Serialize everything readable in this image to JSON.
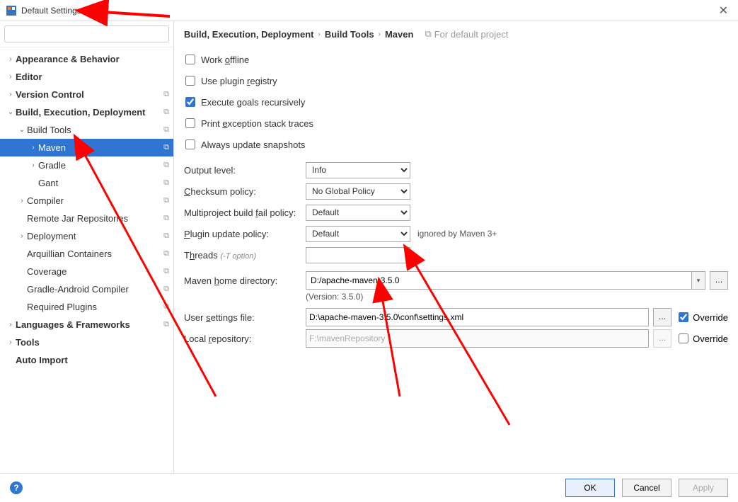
{
  "titlebar": {
    "title": "Default Settings"
  },
  "search": {
    "placeholder": ""
  },
  "tree": [
    {
      "label": "Appearance & Behavior",
      "indent": 0,
      "chev": "›",
      "bold": true,
      "copy": false
    },
    {
      "label": "Editor",
      "indent": 0,
      "chev": "›",
      "bold": true,
      "copy": false
    },
    {
      "label": "Version Control",
      "indent": 0,
      "chev": "›",
      "bold": true,
      "copy": true
    },
    {
      "label": "Build, Execution, Deployment",
      "indent": 0,
      "chev": "⌄",
      "bold": true,
      "copy": true
    },
    {
      "label": "Build Tools",
      "indent": 1,
      "chev": "⌄",
      "bold": false,
      "copy": true
    },
    {
      "label": "Maven",
      "indent": 2,
      "chev": "›",
      "bold": false,
      "copy": true,
      "selected": true
    },
    {
      "label": "Gradle",
      "indent": 2,
      "chev": "›",
      "bold": false,
      "copy": true
    },
    {
      "label": "Gant",
      "indent": 2,
      "chev": "",
      "bold": false,
      "copy": true
    },
    {
      "label": "Compiler",
      "indent": 1,
      "chev": "›",
      "bold": false,
      "copy": true
    },
    {
      "label": "Remote Jar Repositories",
      "indent": 1,
      "chev": "",
      "bold": false,
      "copy": true
    },
    {
      "label": "Deployment",
      "indent": 1,
      "chev": "›",
      "bold": false,
      "copy": true
    },
    {
      "label": "Arquillian Containers",
      "indent": 1,
      "chev": "",
      "bold": false,
      "copy": true
    },
    {
      "label": "Coverage",
      "indent": 1,
      "chev": "",
      "bold": false,
      "copy": true
    },
    {
      "label": "Gradle-Android Compiler",
      "indent": 1,
      "chev": "",
      "bold": false,
      "copy": true
    },
    {
      "label": "Required Plugins",
      "indent": 1,
      "chev": "",
      "bold": false,
      "copy": true
    },
    {
      "label": "Languages & Frameworks",
      "indent": 0,
      "chev": "›",
      "bold": true,
      "copy": true
    },
    {
      "label": "Tools",
      "indent": 0,
      "chev": "›",
      "bold": true,
      "copy": false
    },
    {
      "label": "Auto Import",
      "indent": 0,
      "chev": "",
      "bold": true,
      "copy": false
    }
  ],
  "breadcrumb": {
    "items": [
      "Build, Execution, Deployment",
      "Build Tools",
      "Maven"
    ],
    "hint": "For default project"
  },
  "checks": {
    "work_offline": {
      "label": "Work offline",
      "checked": false
    },
    "use_plugin_registry": {
      "label": "Use plugin registry",
      "checked": false
    },
    "execute_goals_recursively": {
      "label": "Execute goals recursively",
      "checked": true
    },
    "print_exception": {
      "label": "Print exception stack traces",
      "checked": false
    },
    "always_update": {
      "label": "Always update snapshots",
      "checked": false
    }
  },
  "fields": {
    "output_level": {
      "label": "Output level:",
      "value": "Info"
    },
    "checksum_policy": {
      "label": "Checksum policy:",
      "value": "No Global Policy"
    },
    "multiproject_fail": {
      "label": "Multiproject build fail policy:",
      "value": "Default"
    },
    "plugin_update": {
      "label": "Plugin update policy:",
      "value": "Default",
      "after": "ignored by Maven 3+"
    },
    "threads": {
      "label": "Threads",
      "opt": "(-T option)",
      "value": ""
    },
    "maven_home": {
      "label": "Maven home directory:",
      "value": "D:/apache-maven-3.5.0"
    },
    "version": "(Version: 3.5.0)",
    "user_settings": {
      "label": "User settings file:",
      "value": "D:\\apache-maven-3.5.0\\conf\\settings.xml",
      "override": true,
      "override_label": "Override"
    },
    "local_repo": {
      "label": "Local repository:",
      "value": "F:\\mavenRepository",
      "override": false,
      "override_label": "Override"
    }
  },
  "buttons": {
    "ok": "OK",
    "cancel": "Cancel",
    "apply": "Apply"
  }
}
